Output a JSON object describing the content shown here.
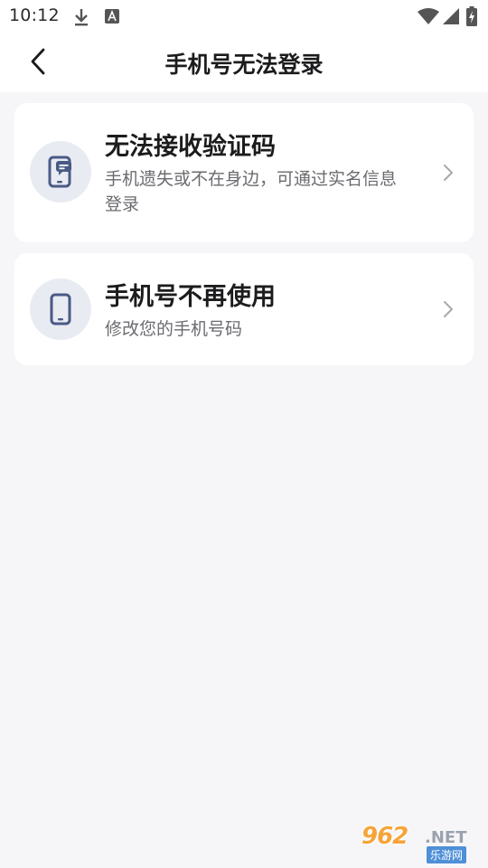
{
  "status_bar": {
    "time": "10:12",
    "icons": [
      "download-icon",
      "a-notification-icon",
      "wifi-icon",
      "signal-icon",
      "battery-charging-icon"
    ]
  },
  "header": {
    "back_icon": "chevron-left-icon",
    "title": "手机号无法登录"
  },
  "options": [
    {
      "icon": "phone-message-icon",
      "title": "无法接收验证码",
      "description": "手机遗失或不在身边，可通过实名信息登录",
      "chevron_icon": "chevron-right-icon"
    },
    {
      "icon": "phone-icon",
      "title": "手机号不再使用",
      "description": "修改您的手机号码",
      "chevron_icon": "chevron-right-icon"
    }
  ],
  "watermark": {
    "number": "962",
    "domain": ".NET",
    "subtitle": "乐游网"
  },
  "colors": {
    "background": "#f6f6f8",
    "card": "#ffffff",
    "icon_bg": "#e9ebf2",
    "icon_fg": "#4a5a86",
    "text_primary": "#1c1c1e",
    "text_secondary": "#6b6b70"
  }
}
